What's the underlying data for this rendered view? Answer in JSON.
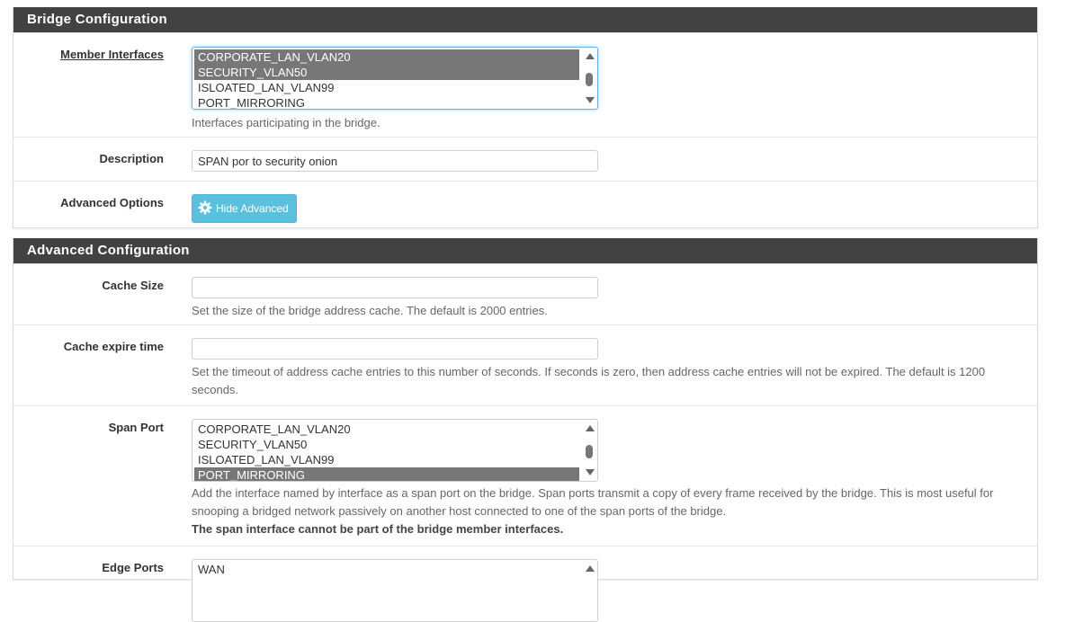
{
  "bridge_config": {
    "heading": "Bridge Configuration",
    "member_interfaces": {
      "label": "Member Interfaces",
      "options": [
        {
          "text": "CORPORATE_LAN_VLAN20",
          "selected": true
        },
        {
          "text": "SECURITY_VLAN50",
          "selected": true
        },
        {
          "text": "ISLOATED_LAN_VLAN99",
          "selected": false
        },
        {
          "text": "PORT_MIRRORING",
          "selected": false
        }
      ],
      "help": "Interfaces participating in the bridge."
    },
    "description": {
      "label": "Description",
      "value": "SPAN por to security onion"
    },
    "advanced_options": {
      "label": "Advanced Options",
      "button_label": "Hide Advanced",
      "icon": "gear-icon"
    }
  },
  "advanced_config": {
    "heading": "Advanced Configuration",
    "cache_size": {
      "label": "Cache Size",
      "value": "",
      "help": "Set the size of the bridge address cache. The default is 2000 entries."
    },
    "cache_expire": {
      "label": "Cache expire time",
      "value": "",
      "help": "Set the timeout of address cache entries to this number of seconds. If seconds is zero, then address cache entries will not be expired. The default is 1200 seconds."
    },
    "span_port": {
      "label": "Span Port",
      "options": [
        {
          "text": "CORPORATE_LAN_VLAN20",
          "selected": false
        },
        {
          "text": "SECURITY_VLAN50",
          "selected": false
        },
        {
          "text": "ISLOATED_LAN_VLAN99",
          "selected": false
        },
        {
          "text": "PORT_MIRRORING",
          "selected": true
        }
      ],
      "help": "Add the interface named by interface as a span port on the bridge. Span ports transmit a copy of every frame received by the bridge. This is most useful for snooping a bridged network passively on another host connected to one of the span ports of the bridge.",
      "help_strong": "The span interface cannot be part of the bridge member interfaces."
    },
    "edge_ports": {
      "label": "Edge Ports",
      "options": [
        {
          "text": "WAN",
          "selected": false
        }
      ]
    }
  },
  "colors": {
    "panel_heading_bg": "#424242",
    "selected_option_bg": "#777777",
    "info_button_bg": "#5bc0de"
  }
}
